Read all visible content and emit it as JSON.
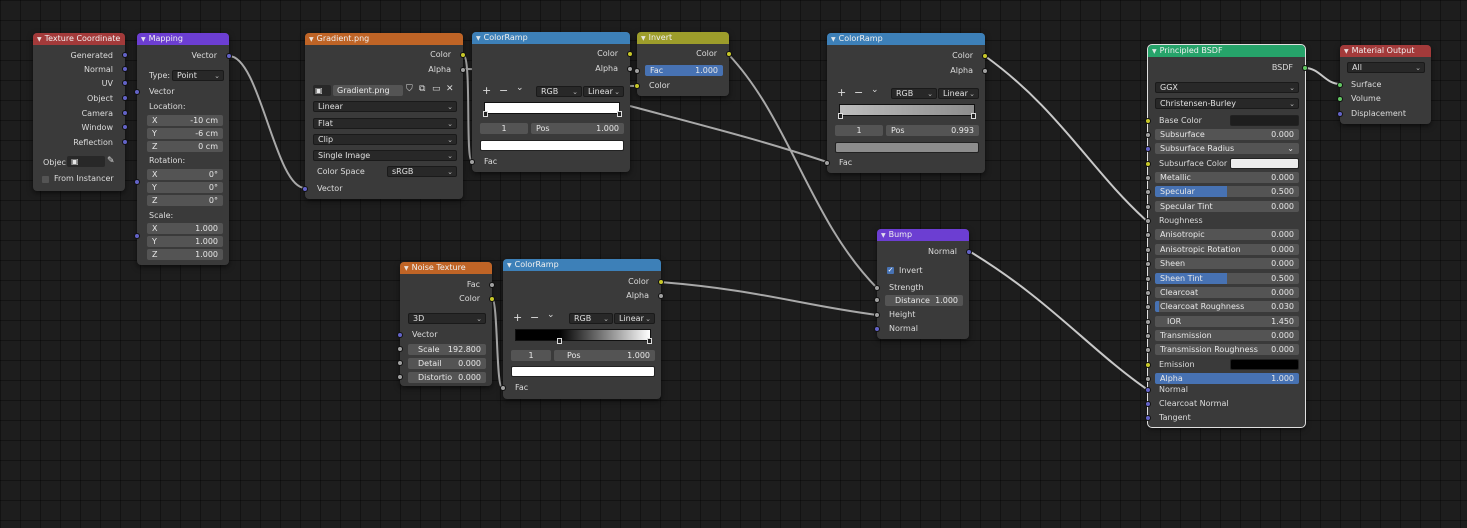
{
  "colors": {
    "input_header": "#a33a3a",
    "vector_header": "#6c3ed2",
    "texture_header": "#bf6426",
    "converter_header": "#3d80b8",
    "color_header": "#9d9d2b",
    "shader_header": "#26a36a",
    "output_header": "#a33a3a",
    "socket_color": "#c7c729",
    "socket_float": "#a1a1a1",
    "socket_vector": "#6363c7",
    "socket_shader": "#63c763",
    "accent_blue": "#4772b3"
  },
  "texcoord": {
    "title": "Texture Coordinate",
    "outputs": [
      "Generated",
      "Normal",
      "UV",
      "Object",
      "Camera",
      "Window",
      "Reflection"
    ],
    "object_label": "Objec",
    "from_instancer": "From Instancer"
  },
  "mapping": {
    "title": "Mapping",
    "output": "Vector",
    "type_label": "Type:",
    "type_value": "Point",
    "vector_input": "Vector",
    "location_label": "Location:",
    "location": [
      {
        "axis": "X",
        "value": "-10 cm"
      },
      {
        "axis": "Y",
        "value": "-6 cm"
      },
      {
        "axis": "Z",
        "value": "0 cm"
      }
    ],
    "rotation_label": "Rotation:",
    "rotation": [
      {
        "axis": "X",
        "value": "0°"
      },
      {
        "axis": "Y",
        "value": "0°"
      },
      {
        "axis": "Z",
        "value": "0°"
      }
    ],
    "scale_label": "Scale:",
    "scale": [
      {
        "axis": "X",
        "value": "1.000"
      },
      {
        "axis": "Y",
        "value": "1.000"
      },
      {
        "axis": "Z",
        "value": "1.000"
      }
    ]
  },
  "gradient": {
    "title": "Gradient.png",
    "out_color": "Color",
    "out_alpha": "Alpha",
    "image_name": "Gradient.png",
    "interpolation": "Linear",
    "projection": "Flat",
    "extension": "Clip",
    "source": "Single Image",
    "colorspace_label": "Color Space",
    "colorspace_value": "sRGB",
    "vector_input": "Vector"
  },
  "ramp1": {
    "title": "ColorRamp",
    "out_color": "Color",
    "out_alpha": "Alpha",
    "mode": "RGB",
    "interp": "Linear",
    "index": "1",
    "pos_label": "Pos",
    "pos_value": "1.000",
    "fac": "Fac"
  },
  "invert": {
    "title": "Invert",
    "out_color": "Color",
    "fac_label": "Fac",
    "fac_value": "1.000",
    "in_color": "Color"
  },
  "ramp2": {
    "title": "ColorRamp",
    "out_color": "Color",
    "out_alpha": "Alpha",
    "mode": "RGB",
    "interp": "Linear",
    "index": "1",
    "pos_label": "Pos",
    "pos_value": "0.993",
    "fac": "Fac"
  },
  "noise": {
    "title": "Noise Texture",
    "out_fac": "Fac",
    "out_color": "Color",
    "dimensions": "3D",
    "vector_input": "Vector",
    "scale_label": "Scale",
    "scale_value": "192.800",
    "detail_label": "Detail",
    "detail_value": "0.000",
    "distortion_label": "Distortio",
    "distortion_value": "0.000"
  },
  "ramp3": {
    "title": "ColorRamp",
    "out_color": "Color",
    "out_alpha": "Alpha",
    "mode": "RGB",
    "interp": "Linear",
    "index": "1",
    "pos_label": "Pos",
    "pos_value": "1.000",
    "fac": "Fac"
  },
  "bump": {
    "title": "Bump",
    "out_normal": "Normal",
    "invert_label": "Invert",
    "invert_checked": true,
    "strength": "Strength",
    "distance_label": "Distance",
    "distance_value": "1.000",
    "height": "Height",
    "normal": "Normal"
  },
  "bsdf": {
    "title": "Principled BSDF",
    "output": "BSDF",
    "distribution": "GGX",
    "subsurface_method": "Christensen-Burley",
    "base_color": "Base Color",
    "rows": [
      {
        "label": "Subsurface",
        "value": "0.000",
        "fill": 0
      },
      {
        "label": "Subsurface Radius",
        "value": "",
        "fill": 0
      },
      {
        "label": "Subsurface Color",
        "value": "",
        "fill": 0
      },
      {
        "label": "Metallic",
        "value": "0.000",
        "fill": 0
      },
      {
        "label": "Specular",
        "value": "0.500",
        "fill": 0.5
      },
      {
        "label": "Specular Tint",
        "value": "0.000",
        "fill": 0
      },
      {
        "label": "Roughness",
        "value": "",
        "fill": 0
      },
      {
        "label": "Anisotropic",
        "value": "0.000",
        "fill": 0
      },
      {
        "label": "Anisotropic Rotation",
        "value": "0.000",
        "fill": 0
      },
      {
        "label": "Sheen",
        "value": "0.000",
        "fill": 0
      },
      {
        "label": "Sheen Tint",
        "value": "0.500",
        "fill": 0.5
      },
      {
        "label": "Clearcoat",
        "value": "0.000",
        "fill": 0
      },
      {
        "label": "Clearcoat Roughness",
        "value": "0.030",
        "fill": 0.03
      },
      {
        "label": "IOR",
        "value": "1.450",
        "fill": 0
      },
      {
        "label": "Transmission",
        "value": "0.000",
        "fill": 0
      },
      {
        "label": "Transmission Roughness",
        "value": "0.000",
        "fill": 0
      },
      {
        "label": "Emission",
        "value": "",
        "fill": 0
      },
      {
        "label": "Alpha",
        "value": "1.000",
        "fill": 1
      }
    ],
    "normal": "Normal",
    "clearcoat_normal": "Clearcoat Normal",
    "tangent": "Tangent"
  },
  "output": {
    "title": "Material Output",
    "target": "All",
    "surface": "Surface",
    "volume": "Volume",
    "displacement": "Displacement"
  }
}
